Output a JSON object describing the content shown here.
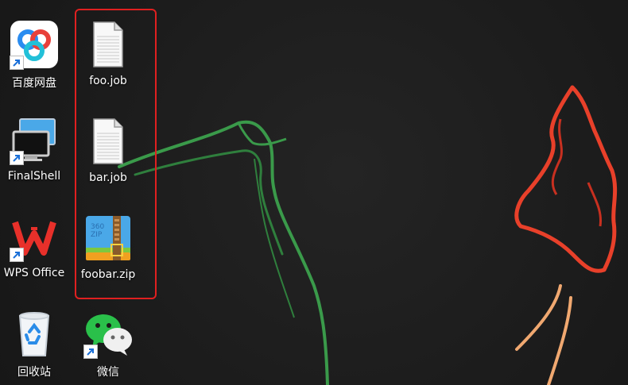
{
  "desktop": {
    "icons": [
      {
        "label": "百度网盘",
        "icon": "baidu-netdisk-icon",
        "shortcut": true
      },
      {
        "label": "FinalShell",
        "icon": "monitor-icon",
        "shortcut": true
      },
      {
        "label": "WPS Office",
        "icon": "wps-icon",
        "shortcut": true
      },
      {
        "label": "回收站",
        "icon": "recycle-bin-icon",
        "shortcut": false
      },
      {
        "label": "foo.job",
        "icon": "document-icon",
        "shortcut": false
      },
      {
        "label": "bar.job",
        "icon": "document-icon",
        "shortcut": false
      },
      {
        "label": "foobar.zip",
        "icon": "zip-archive-icon",
        "shortcut": false
      },
      {
        "label": "微信",
        "icon": "wechat-icon",
        "shortcut": true
      }
    ]
  },
  "colors": {
    "selection_highlight": "#e02020",
    "wallpaper_green": "#3a9a4a",
    "wallpaper_red": "#e8402a",
    "wallpaper_orange": "#f0a870"
  }
}
